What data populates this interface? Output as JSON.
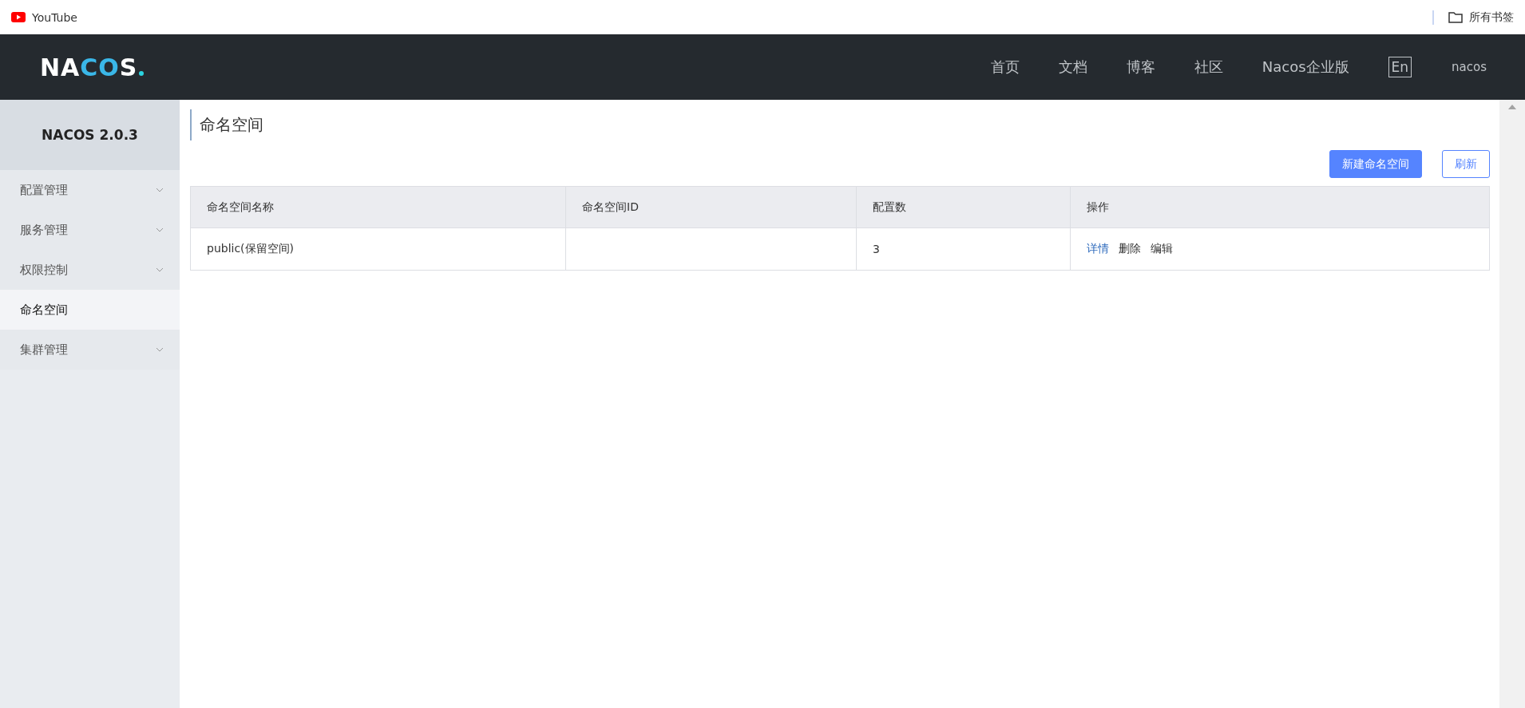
{
  "bookmarks_bar": {
    "items": [
      {
        "label": "YouTube",
        "kind": "site"
      }
    ],
    "all_bookmarks": "所有书签"
  },
  "header": {
    "logo": "NACOS",
    "nav": [
      "首页",
      "文档",
      "博客",
      "社区",
      "Nacos企业版"
    ],
    "language": "En",
    "user": "nacos"
  },
  "sidebar": {
    "title": "NACOS 2.0.3",
    "items": [
      {
        "label": "配置管理",
        "expandable": true,
        "selected": false
      },
      {
        "label": "服务管理",
        "expandable": true,
        "selected": false
      },
      {
        "label": "权限控制",
        "expandable": true,
        "selected": false
      },
      {
        "label": "命名空间",
        "expandable": false,
        "selected": true
      },
      {
        "label": "集群管理",
        "expandable": true,
        "selected": false
      }
    ]
  },
  "page": {
    "title": "命名空间",
    "buttons": [
      {
        "label": "新建命名空间",
        "kind": "primary"
      },
      {
        "label": "刷新",
        "kind": "outline"
      }
    ]
  },
  "table": {
    "columns": [
      "命名空间名称",
      "命名空间ID",
      "配置数",
      "操作"
    ],
    "rows": [
      {
        "cells": [
          "public(保留空间)",
          "",
          "3"
        ],
        "actions": [
          {
            "label": "详情",
            "kind": "link"
          },
          {
            "label": "删除",
            "kind": "text"
          },
          {
            "label": "编辑",
            "kind": "text"
          }
        ]
      }
    ]
  }
}
